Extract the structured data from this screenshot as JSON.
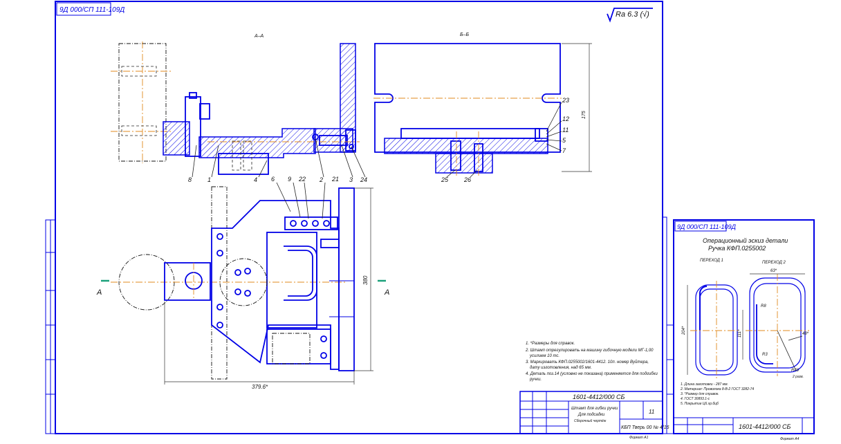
{
  "main_sheet": {
    "top_code": "9Д 000/СП 111-109Д",
    "roughness": "Ra 6.3 (√)",
    "section_a_label": "А–А",
    "section_b_label": "Б–Б",
    "view_marker_left": "А",
    "view_marker_right": "А",
    "balloons": [
      "8",
      "1",
      "4",
      "2",
      "3",
      "24",
      "6",
      "9",
      "22",
      "21",
      "23",
      "12",
      "11",
      "5",
      "7",
      "25",
      "26"
    ],
    "dimensions": {
      "width": "379.6*",
      "height_right": "380",
      "height_section_b": "175"
    },
    "notes": [
      "1. *Размеры для справок.",
      "2. Штамп отрегулировать на машину гибочную модели МГ-1,00",
      "усилием 10 тс.",
      "3. Маркировать КФП.0255002/1601-4412. 10п. номер Вуйтера,",
      "дату изготовления, над 65 мм.",
      "4. Деталь поз.14 (условно не показана) применяется для подгибки",
      "ручки."
    ],
    "title_block": {
      "code": "1601-4412/000 СБ",
      "name_line1": "Штамп для гибки ручки",
      "name_line2": "Для подсадки",
      "name_line3": "Сборочный чертёж",
      "sheet": "11",
      "org": "КБП Тверь 00 № 4/16",
      "format": "Формат А1"
    }
  },
  "side_sheet": {
    "top_code": "9Д 000/СП 111-109Д",
    "title_line1": "Операционный эскиз детали",
    "title_line2": "Ручка КФП.0255002",
    "step1": "ПЕРЕХОД 1",
    "step2": "ПЕРЕХОД 2",
    "dims": {
      "d1": "63*",
      "d2": "204*",
      "d3": "111*",
      "d4": "48*",
      "d5": "R40",
      "d6": "2 разв.",
      "d7": "R3",
      "d8": "R8"
    },
    "notes": [
      "1. Длина заготовки - 287 мм.",
      "2. Материал: Проволока 8-В-2 ГОСТ 3282-74",
      "3. *Размер для справок.",
      "4. ГОСТ 30893.1-с",
      "5. Покрытие Ц6.хр.бцб"
    ],
    "code": "1601-4412/000 СБ",
    "format": "Формат А4"
  }
}
